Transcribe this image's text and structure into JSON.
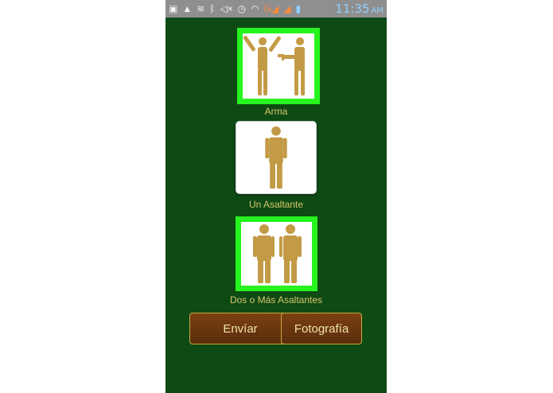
{
  "status_bar": {
    "icons": [
      "image-icon",
      "warning-icon",
      "download-icon",
      "bluetooth-icon",
      "mute-icon",
      "alarm-icon",
      "wifi-icon",
      "signal-icon",
      "signal-icon",
      "battery-icon"
    ],
    "time": "11:35",
    "ampm": "AM"
  },
  "options": [
    {
      "label": "Arma",
      "icon": "armed-robbery-icon",
      "selected": true
    },
    {
      "label": "Un Asaltante",
      "icon": "single-person-icon",
      "selected": false
    },
    {
      "label": "Dos o Más Asaltantes",
      "icon": "two-people-icon",
      "selected": true
    }
  ],
  "buttons": {
    "send": "Envíar",
    "photo": "Fotografía"
  },
  "colors": {
    "background": "#0e4a14",
    "figure": "#c39a45",
    "selected_border": "#27f31f",
    "label": "#d6c66a",
    "button": "#6b3510"
  }
}
